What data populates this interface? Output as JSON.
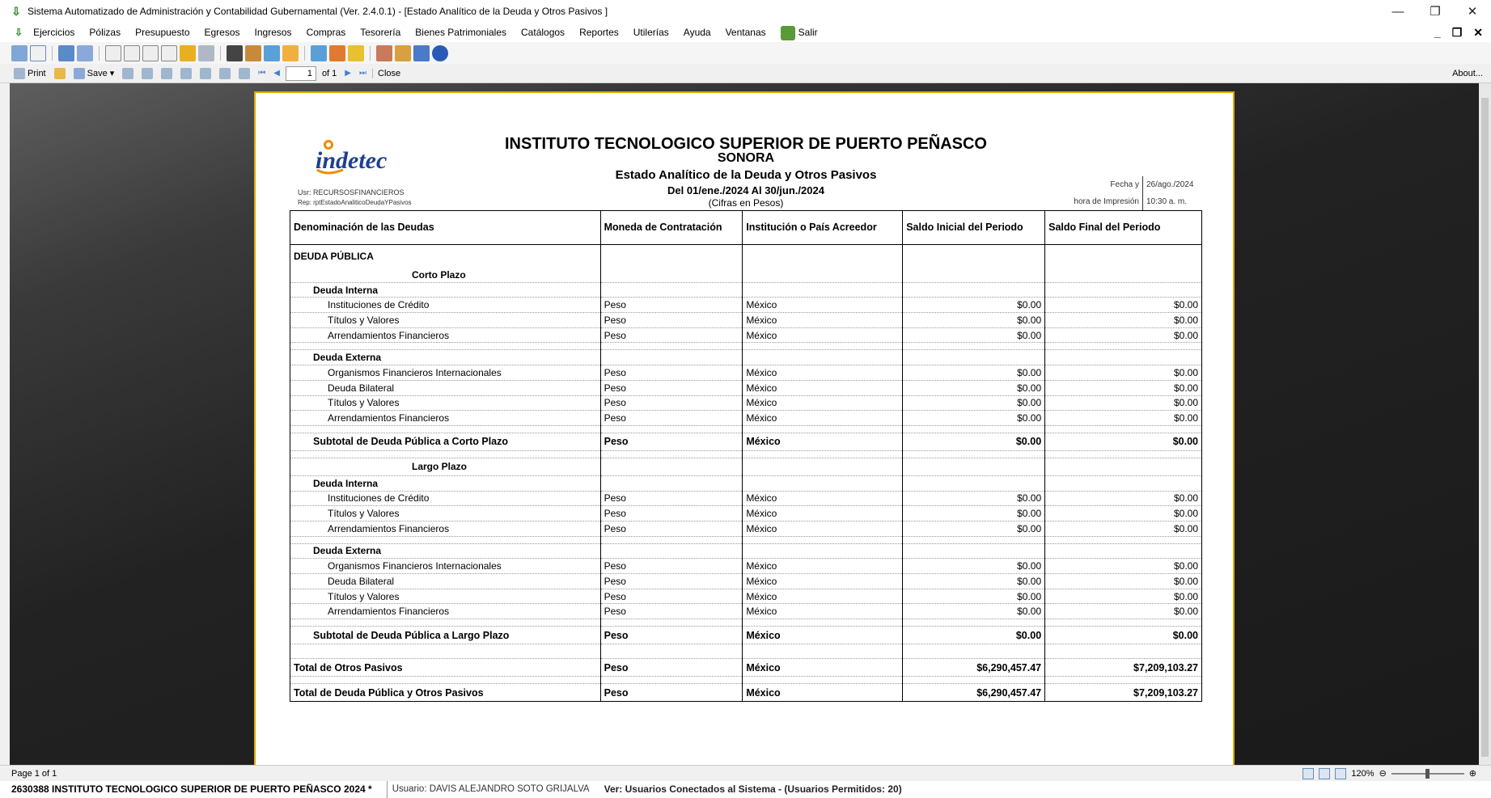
{
  "window": {
    "title": "Sistema Automatizado de Administración y Contabilidad Gubernamental  (Ver. 2.4.0.1) - [Estado Analítico de la Deuda y Otros Pasivos ]",
    "minimize": "—",
    "restore": "❐",
    "close": "✕"
  },
  "menu": {
    "items": [
      "Ejercicios",
      "Pólizas",
      "Presupuesto",
      "Egresos",
      "Ingresos",
      "Compras",
      "Tesorería",
      "Bienes Patrimoniales",
      "Catálogos",
      "Reportes",
      "Utilerías",
      "Ayuda",
      "Ventanas"
    ],
    "exit_label": "Salir",
    "mdi_min": "_",
    "mdi_restore": "❐",
    "mdi_close": "✕"
  },
  "report_toolbar": {
    "print_label": "Print",
    "save_label": "Save",
    "page_value": "1",
    "page_of": "of 1",
    "close_label": "Close",
    "about_label": "About..."
  },
  "report": {
    "logo_text": "indetec",
    "institution": "INSTITUTO TECNOLOGICO SUPERIOR DE PUERTO PEÑASCO",
    "state": "SONORA",
    "report_name": "Estado Analítico de la Deuda y Otros Pasivos",
    "period": "Del 01/ene./2024 Al 30/jun./2024",
    "units": "(Cifras en Pesos)",
    "user_line": "Usr: RECURSOSFINANCIEROS",
    "rep_line": "Rep: rptEstadoAnaliticoDeudaYPasivos",
    "fecha_label": "Fecha y",
    "fecha_value": "26/ago./2024",
    "hora_label": "hora de Impresión",
    "hora_value": "10:30 a. m.",
    "columns": [
      "Denominación de las Deudas",
      "Moneda de Contratación",
      "Institución o País Acreedor",
      "Saldo Inicial del Periodo",
      "Saldo Final del Periodo"
    ],
    "deuda_publica": "DEUDA PÚBLICA",
    "corto_plazo": "Corto Plazo",
    "largo_plazo": "Largo Plazo",
    "deuda_interna": "Deuda Interna",
    "deuda_externa": "Deuda Externa",
    "cp_interna": [
      {
        "name": "Instituciones de Crédito",
        "moneda": "Peso",
        "pais": "México",
        "inicial": "$0.00",
        "final": "$0.00"
      },
      {
        "name": "Títulos y Valores",
        "moneda": "Peso",
        "pais": "México",
        "inicial": "$0.00",
        "final": "$0.00"
      },
      {
        "name": "Arrendamientos Financieros",
        "moneda": "Peso",
        "pais": "México",
        "inicial": "$0.00",
        "final": "$0.00"
      }
    ],
    "cp_externa": [
      {
        "name": "Organismos Financieros Internacionales",
        "moneda": "Peso",
        "pais": "México",
        "inicial": "$0.00",
        "final": "$0.00"
      },
      {
        "name": "Deuda Bilateral",
        "moneda": "Peso",
        "pais": "México",
        "inicial": "$0.00",
        "final": "$0.00"
      },
      {
        "name": "Títulos y Valores",
        "moneda": "Peso",
        "pais": "México",
        "inicial": "$0.00",
        "final": "$0.00"
      },
      {
        "name": "Arrendamientos Financieros",
        "moneda": "Peso",
        "pais": "México",
        "inicial": "$0.00",
        "final": "$0.00"
      }
    ],
    "cp_subtotal": {
      "name": "Subtotal de Deuda Pública a Corto Plazo",
      "moneda": "Peso",
      "pais": "México",
      "inicial": "$0.00",
      "final": "$0.00"
    },
    "lp_interna": [
      {
        "name": "Instituciones de Crédito",
        "moneda": "Peso",
        "pais": "México",
        "inicial": "$0.00",
        "final": "$0.00"
      },
      {
        "name": "Títulos y Valores",
        "moneda": "Peso",
        "pais": "México",
        "inicial": "$0.00",
        "final": "$0.00"
      },
      {
        "name": "Arrendamientos Financieros",
        "moneda": "Peso",
        "pais": "México",
        "inicial": "$0.00",
        "final": "$0.00"
      }
    ],
    "lp_externa": [
      {
        "name": "Organismos Financieros Internacionales",
        "moneda": "Peso",
        "pais": "México",
        "inicial": "$0.00",
        "final": "$0.00"
      },
      {
        "name": "Deuda Bilateral",
        "moneda": "Peso",
        "pais": "México",
        "inicial": "$0.00",
        "final": "$0.00"
      },
      {
        "name": "Títulos y Valores",
        "moneda": "Peso",
        "pais": "México",
        "inicial": "$0.00",
        "final": "$0.00"
      },
      {
        "name": "Arrendamientos Financieros",
        "moneda": "Peso",
        "pais": "México",
        "inicial": "$0.00",
        "final": "$0.00"
      }
    ],
    "lp_subtotal": {
      "name": "Subtotal de Deuda Pública a Largo Plazo",
      "moneda": "Peso",
      "pais": "México",
      "inicial": "$0.00",
      "final": "$0.00"
    },
    "otros_pasivos": {
      "name": "Total de Otros Pasivos",
      "moneda": "Peso",
      "pais": "México",
      "inicial": "$6,290,457.47",
      "final": "$7,209,103.27"
    },
    "gran_total": {
      "name": "Total de Deuda Pública y Otros Pasivos",
      "moneda": "Peso",
      "pais": "México",
      "inicial": "$6,290,457.47",
      "final": "$7,209,103.27"
    }
  },
  "status": {
    "page_info": "Page 1 of 1",
    "zoom": "120%",
    "institution": "2630388 INSTITUTO TECNOLOGICO SUPERIOR DE PUERTO PEÑASCO  2024  *",
    "user": "Usuario: DAVIS ALEJANDRO SOTO GRIJALVA",
    "connected": "Ver: Usuarios Conectados al Sistema - (Usuarios Permitidos: 20)"
  },
  "colors": {
    "page_border": "#e0a800",
    "logo_orange": "#f08a00",
    "logo_blue": "#1d3f8f"
  }
}
